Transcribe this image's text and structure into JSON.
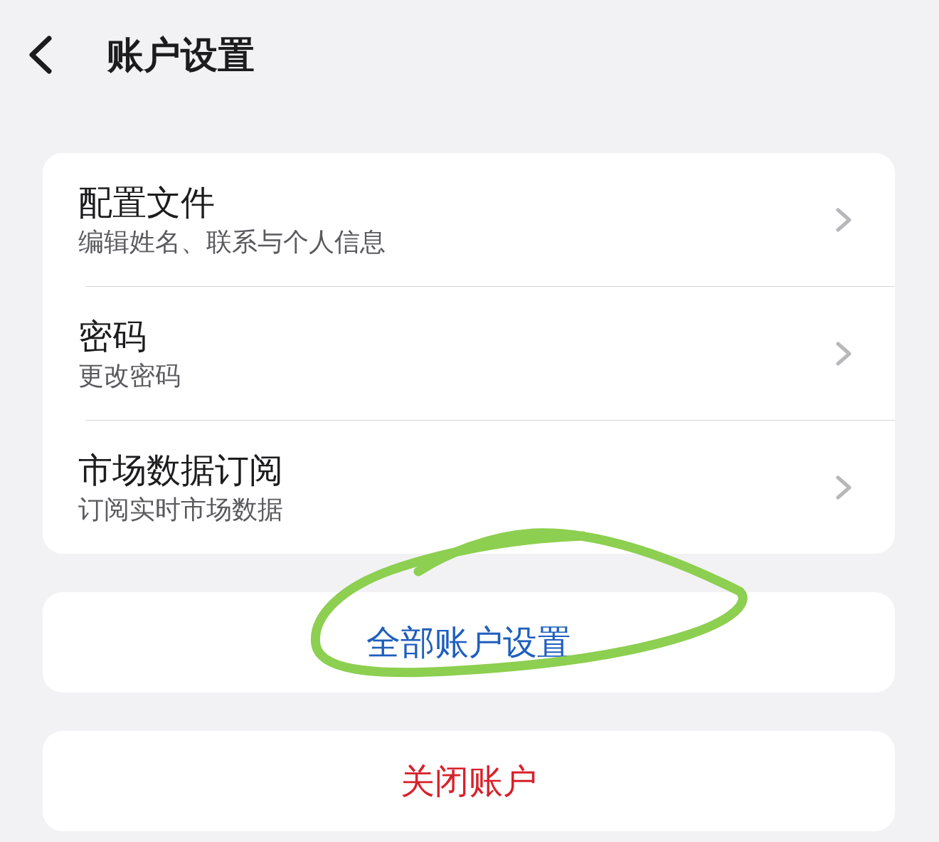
{
  "header": {
    "title": "账户设置"
  },
  "settings": [
    {
      "title": "配置文件",
      "subtitle": "编辑姓名、联系与个人信息"
    },
    {
      "title": "密码",
      "subtitle": "更改密码"
    },
    {
      "title": "市场数据订阅",
      "subtitle": "订阅实时市场数据"
    }
  ],
  "actions": [
    {
      "label": "全部账户设置",
      "kind": "link",
      "circled": true
    },
    {
      "label": "关闭账户",
      "kind": "destructive",
      "circled": false
    }
  ]
}
